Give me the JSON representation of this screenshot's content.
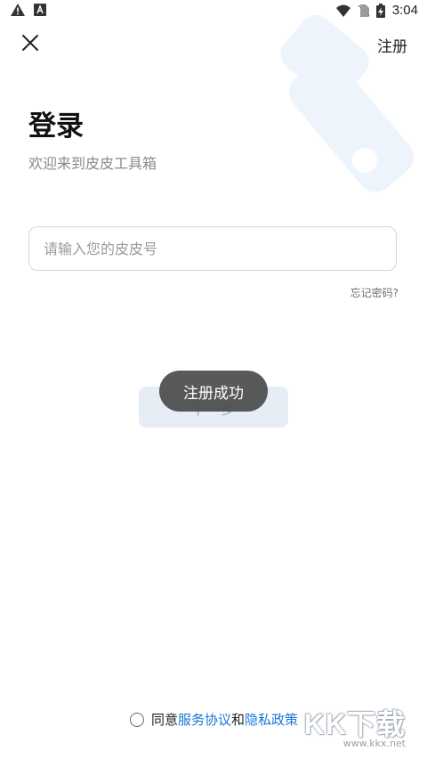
{
  "status_bar": {
    "time": "3:04",
    "left_icons": [
      "warning-icon",
      "font-icon"
    ],
    "right_icons": [
      "wifi-icon",
      "no-sim-icon",
      "battery-charging-icon"
    ]
  },
  "header": {
    "close_icon": "close-icon",
    "register_label": "注册"
  },
  "main": {
    "title": "登录",
    "subtitle": "欢迎来到皮皮工具箱",
    "account_input": {
      "placeholder": "请输入您的皮皮号",
      "value": ""
    },
    "forgot_password_label": "忘记密码?",
    "next_button_label": "下一步"
  },
  "toast": {
    "text": "注册成功"
  },
  "footer": {
    "agree_prefix": "同意",
    "terms_label": "服务协议",
    "conjunction": "和",
    "privacy_label": "隐私政策"
  },
  "watermark": {
    "brand": "KK下载",
    "url": "www.kkx.net"
  },
  "colors": {
    "accent_link": "#1677d9",
    "button_disabled_bg": "#e6edf4",
    "toast_bg": "#4b4b4b",
    "background_wrench": "#eef4fb"
  }
}
